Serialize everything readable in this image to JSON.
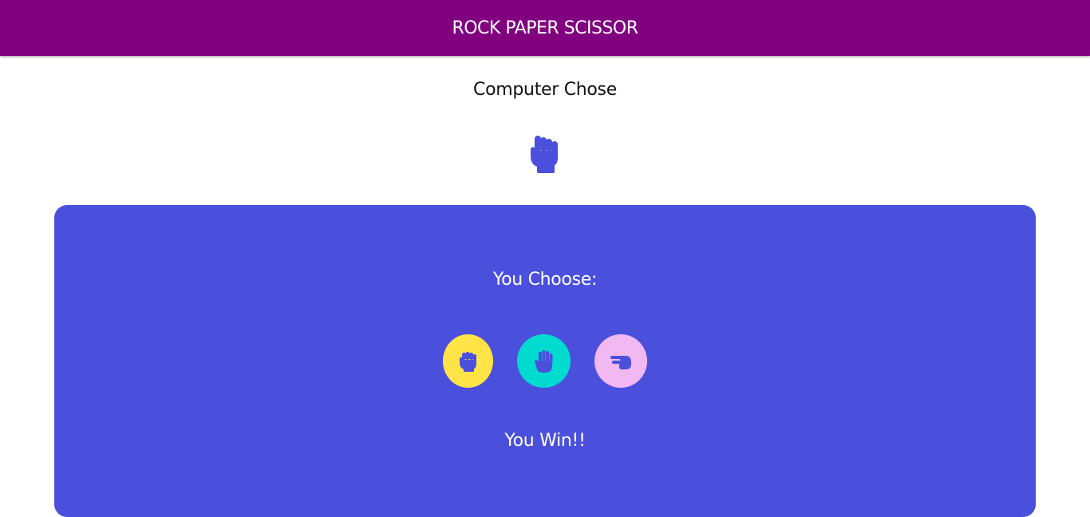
{
  "app": {
    "title": "ROCK PAPER SCISSOR",
    "header_color": "#800080"
  },
  "computer": {
    "label": "Computer Chose",
    "choice_icon": "rock-hand-icon",
    "icon_color": "#4b50dc"
  },
  "player": {
    "label": "You Choose:",
    "panel_color": "#4b50dc",
    "choices": [
      {
        "name": "rock",
        "icon": "fist-icon",
        "bg": "#ffe347"
      },
      {
        "name": "paper",
        "icon": "open-hand-icon",
        "bg": "#00dbd0"
      },
      {
        "name": "scissor",
        "icon": "scissors-hand-icon",
        "bg": "#f2b8f2"
      }
    ]
  },
  "result": {
    "text": "You Win!!"
  }
}
